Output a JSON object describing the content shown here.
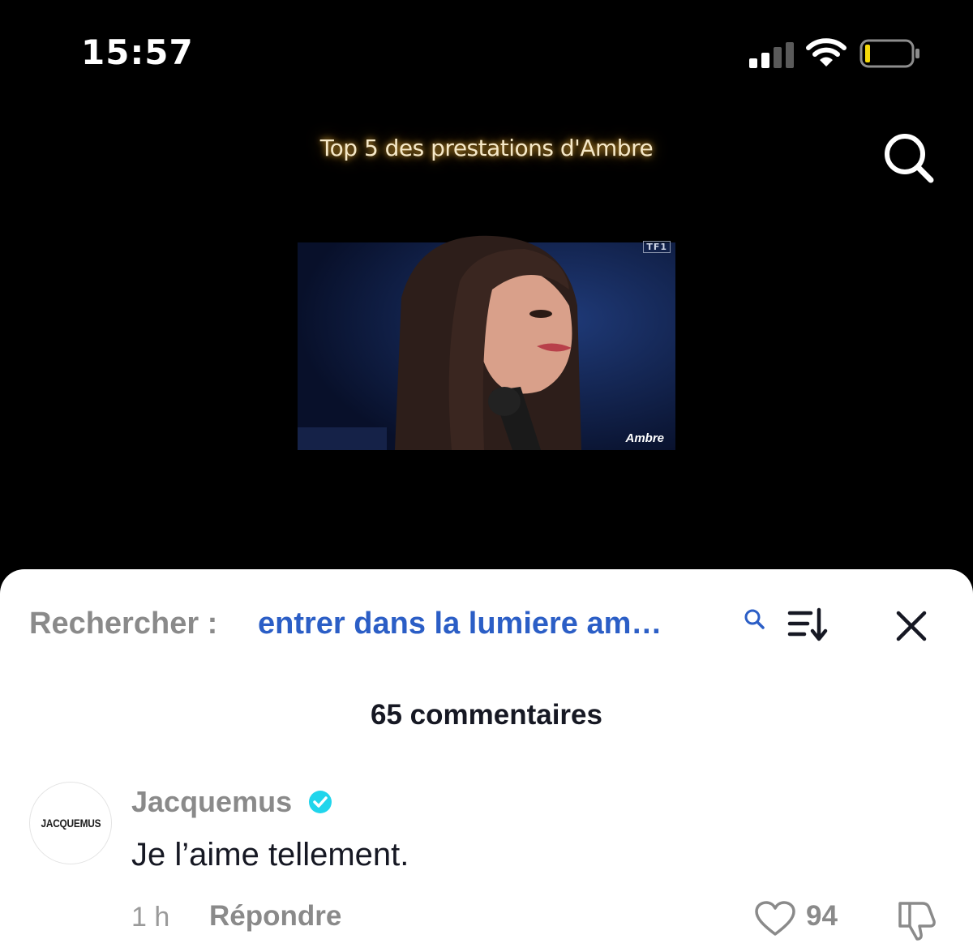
{
  "status_bar": {
    "time": "15:57"
  },
  "video": {
    "title": "Top 5 des prestations d'Ambre",
    "channel_logo": "TF1",
    "name_overlay": "Ambre"
  },
  "comments_sheet": {
    "search_prefix": "Rechercher :",
    "search_query": "entrer dans la lumiere am…",
    "count_label": "65 commentaires",
    "accent_color": "#2b5ec6",
    "comments": [
      {
        "avatar_text": "JACQUEMUS",
        "username": "Jacquemus",
        "verified": true,
        "text": "Je l’aime tellement.",
        "time": "1 h",
        "reply_label": "Répondre",
        "likes": "94"
      }
    ]
  }
}
